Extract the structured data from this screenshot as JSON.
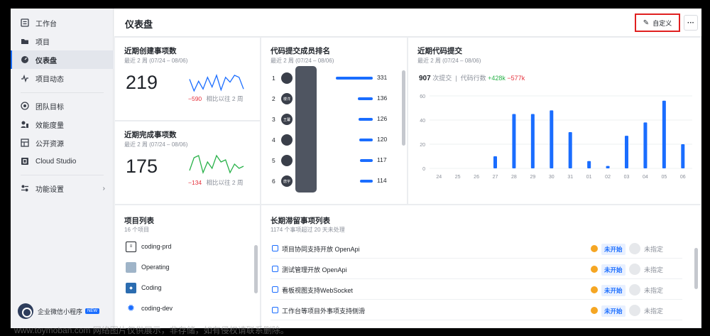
{
  "sidebar": {
    "items": [
      {
        "label": "工作台",
        "icon": "workbench-icon"
      },
      {
        "label": "项目",
        "icon": "folder-icon"
      },
      {
        "label": "仪表盘",
        "icon": "dashboard-icon",
        "active": true
      },
      {
        "label": "项目动态",
        "icon": "activity-icon"
      },
      {
        "label": "团队目标",
        "icon": "target-icon"
      },
      {
        "label": "效能度量",
        "icon": "metrics-icon"
      },
      {
        "label": "公开资源",
        "icon": "resources-icon"
      },
      {
        "label": "Cloud Studio",
        "icon": "cloud-studio-icon"
      },
      {
        "label": "功能设置",
        "icon": "settings-icon"
      }
    ],
    "miniprogram": {
      "label": "企业微信小程序",
      "badge": "NEW"
    }
  },
  "header": {
    "title": "仪表盘",
    "custom_label": "自定义",
    "more_label": "···"
  },
  "created": {
    "title": "近期创建事项数",
    "subtitle": "最近 2 周 (07/24 – 08/06)",
    "value": "219",
    "delta": "−590",
    "compare": "相比以往 2 周",
    "sparkline": [
      20,
      8,
      18,
      10,
      22,
      12,
      24,
      9,
      22,
      17,
      24,
      22,
      10
    ]
  },
  "completed": {
    "title": "近期完成事项数",
    "subtitle": "最近 2 周 (07/24 – 08/06)",
    "value": "175",
    "delta": "−134",
    "compare": "相比以往 2 周",
    "sparkline": [
      8,
      20,
      22,
      6,
      16,
      10,
      22,
      16,
      18,
      6,
      14,
      10,
      12
    ]
  },
  "ranking": {
    "title": "代码提交成员排名",
    "subtitle": "最近 2 周 (07/24 – 08/06)",
    "max": 331,
    "rows": [
      {
        "rank": "1",
        "avatar": "",
        "value": "331"
      },
      {
        "rank": "2",
        "avatar": "楼洋",
        "value": "136"
      },
      {
        "rank": "3",
        "avatar": "王馨",
        "value": "126"
      },
      {
        "rank": "4",
        "avatar": "",
        "value": "120"
      },
      {
        "rank": "5",
        "avatar": "",
        "value": "117"
      },
      {
        "rank": "6",
        "avatar": "唐宇",
        "value": "114"
      }
    ]
  },
  "commits": {
    "title": "近期代码提交",
    "subtitle": "最近 2 周 (07/24 – 08/06)",
    "count": "907",
    "count_label": "次提交",
    "lines_label": "代码行数",
    "added": "+428k",
    "removed": "−577k",
    "color": "#1a6dff",
    "chart_data": {
      "type": "bar",
      "categories": [
        "24",
        "25",
        "26",
        "27",
        "28",
        "29",
        "30",
        "31",
        "01",
        "02",
        "03",
        "04",
        "05",
        "06"
      ],
      "values": [
        0,
        0,
        0,
        10,
        45,
        45,
        48,
        30,
        6,
        2,
        27,
        38,
        56,
        20
      ],
      "yticks": [
        "0",
        "20",
        "40",
        "60"
      ],
      "ylim": [
        0,
        60
      ],
      "grid": true
    }
  },
  "projects": {
    "title": "项目列表",
    "subtitle": "16 个项目",
    "items": [
      {
        "name": "coding-prd",
        "icon": "document-icon"
      },
      {
        "name": "Operating",
        "icon": "operating-icon"
      },
      {
        "name": "Coding",
        "icon": "coding-icon"
      },
      {
        "name": "coding-dev",
        "icon": "gear-icon"
      }
    ]
  },
  "issues": {
    "title": "长期滞留事项列表",
    "subtitle": "1174 个事项超过 20 天未处理",
    "rows": [
      {
        "title": "项目协同支持开放 OpenApi",
        "status": "未开始",
        "assignee": "未指定"
      },
      {
        "title": "测试管理开放 OpenApi",
        "status": "未开始",
        "assignee": "未指定"
      },
      {
        "title": "看板视图支持WebSocket",
        "status": "未开始",
        "assignee": "未指定"
      },
      {
        "title": "工作台等项目外事项支持侧滑",
        "status": "未开始",
        "assignee": "未指定"
      }
    ]
  },
  "watermark": "www.toymoban.com 网络图片仅供展示，非存储，如有侵权请联系删除。"
}
